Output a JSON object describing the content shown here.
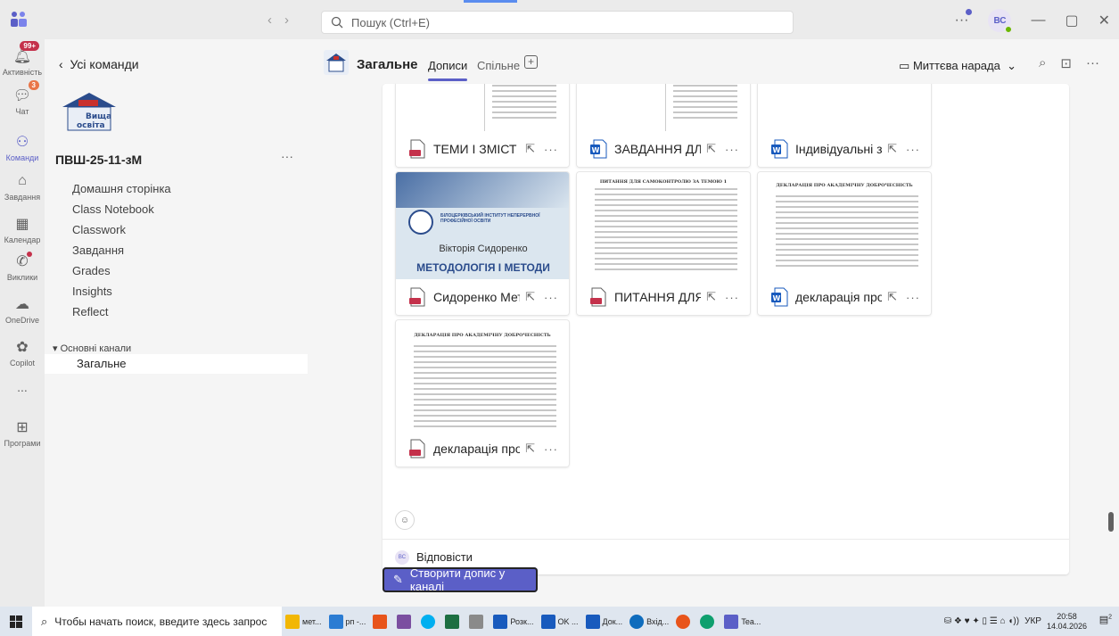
{
  "titlebar": {
    "search_placeholder": "Пошук (Ctrl+E)",
    "avatar_initials": "ВС"
  },
  "rail": {
    "activity": {
      "label": "Активність",
      "badge": "99+"
    },
    "chat": {
      "label": "Чат",
      "badge": "3"
    },
    "teams": {
      "label": "Команди"
    },
    "assignments": {
      "label": "Завдання"
    },
    "calendar": {
      "label": "Календар"
    },
    "calls": {
      "label": "Виклики"
    },
    "onedrive": {
      "label": "OneDrive"
    },
    "copilot": {
      "label": "Copilot"
    },
    "more": {
      "label": "..."
    },
    "apps": {
      "label": "Програми"
    }
  },
  "teampane": {
    "back_label": "Усі команди",
    "logo_text": "Вища освіта",
    "team_name": "ПВШ-25-11-зМ",
    "more": "···",
    "nav": [
      "Домашня сторінка",
      "Class Notebook",
      "Classwork",
      "Завдання",
      "Grades",
      "Insights",
      "Reflect"
    ],
    "channels_header": "Основні канали",
    "channel": "Загальне"
  },
  "channel": {
    "name": "Загальне",
    "tabs": [
      "Дописи",
      "Спільне"
    ],
    "meet_now": "Миттєва нарада",
    "reply_label": "Відповісти",
    "reply_initials": "ВС",
    "new_post_label": "Створити допис у каналі"
  },
  "files": [
    {
      "name": "ТЕМИ І ЗМІСТ ...",
      "type": "pdf"
    },
    {
      "name": "ЗАВДАННЯ ДЛ...",
      "type": "word"
    },
    {
      "name": "Індивідуальні з...",
      "type": "word"
    },
    {
      "name": "Сидоренко Мет...",
      "type": "pdf",
      "thumb_org": "БІЛОЦЕРКІВСЬКИЙ ІНСТИТУТ НЕПЕРЕРВНОЇ ПРОФЕСІЙНОЇ ОСВІТИ",
      "thumb_author": "Вікторія Сидоренко",
      "thumb_title": "МЕТОДОЛОГІЯ І МЕТОДИ"
    },
    {
      "name": "ПИТАННЯ ДЛЯ ...",
      "type": "pdf",
      "thumb_title": "ПИТАННЯ ДЛЯ САМОКОНТРОЛЮ ЗА ТЕМОЮ 1"
    },
    {
      "name": "декларація про...",
      "type": "word",
      "thumb_title": "ДЕКЛАРАЦІЯ ПРО АКАДЕМІЧНУ ДОБРОЧЕСНІСТЬ"
    },
    {
      "name": "декларація про...",
      "type": "pdf",
      "thumb_title": "ДЕКЛАРАЦІЯ ПРО АКАДЕМІЧНУ ДОБРОЧЕСНІСТЬ"
    }
  ],
  "taskbar": {
    "search_placeholder": "Чтобы начать поиск, введите здесь запрос",
    "apps": [
      "мет...",
      "рп -...",
      "",
      "",
      "",
      "",
      "",
      "Розк...",
      "OK ...",
      "Док...",
      "Вхід...",
      "",
      "",
      "Tea..."
    ],
    "language": "УКР",
    "time": "20:58",
    "date": "14.04.2026",
    "notif_count": "2"
  },
  "colors": {
    "accent": "#5b5fc7",
    "pdf": "#c4314b",
    "word": "#185abd",
    "badge": "#c4314b"
  }
}
